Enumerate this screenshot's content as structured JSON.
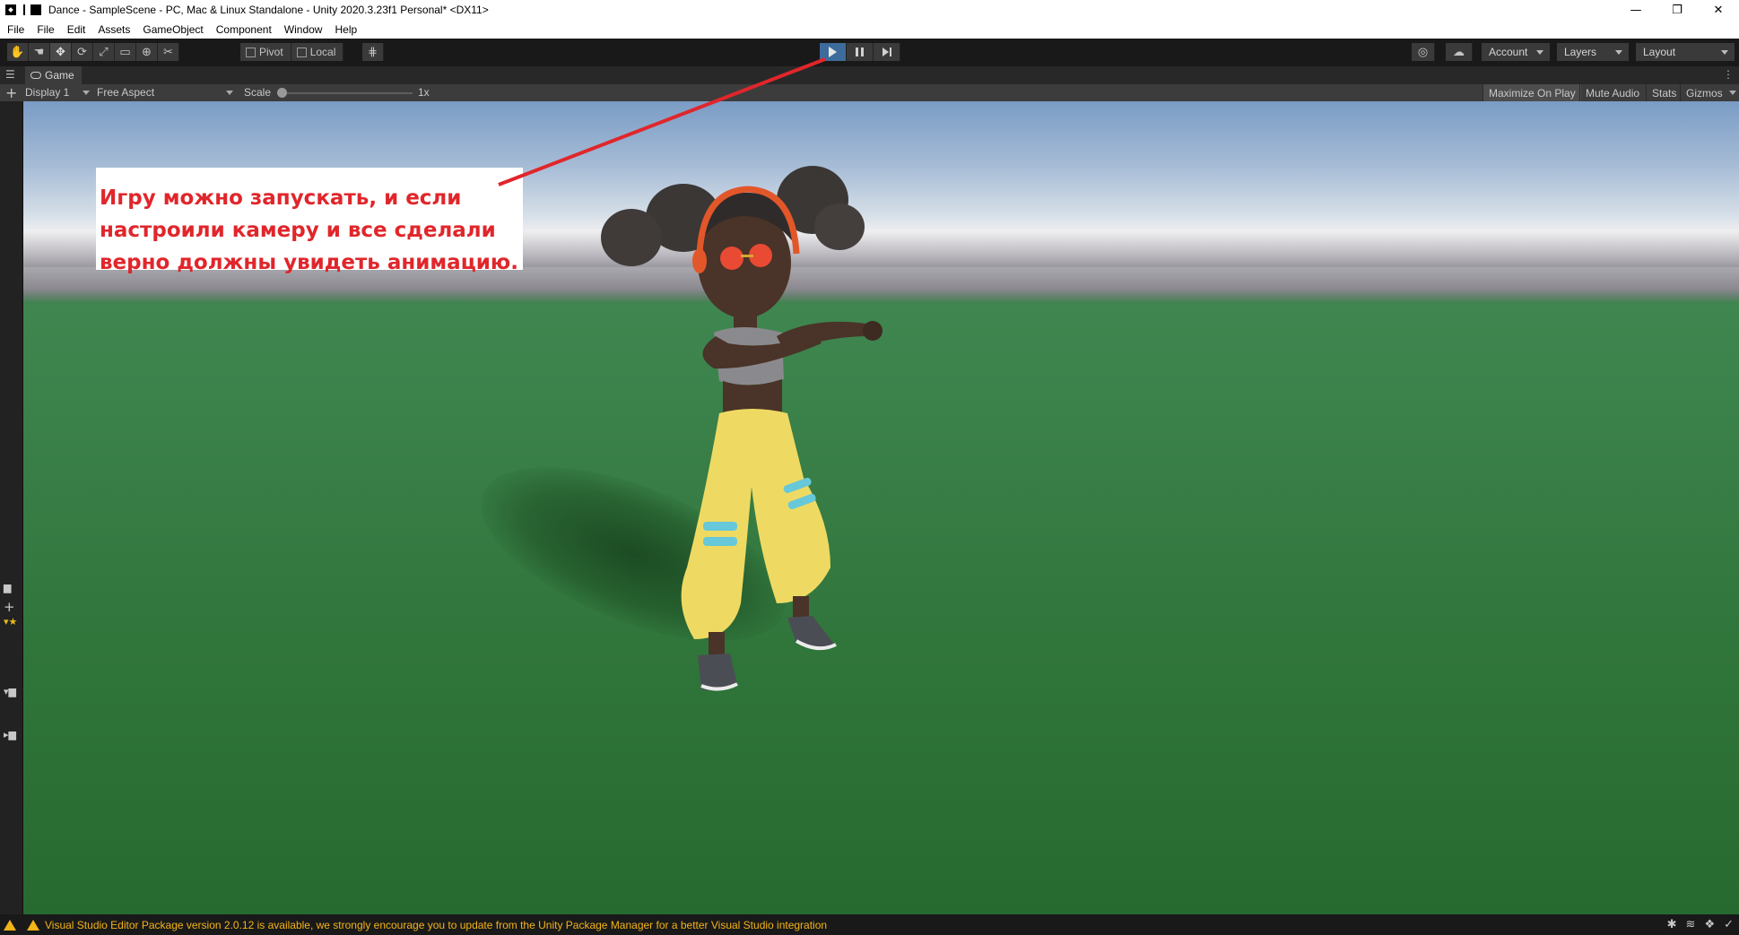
{
  "window": {
    "title": "Dance - SampleScene - PC, Mac & Linux Standalone - Unity 2020.3.23f1 Personal* <DX11>",
    "minimize_glyph": "—",
    "restore_glyph": "❐",
    "close_glyph": "✕"
  },
  "menubar": {
    "items": [
      "File",
      "File",
      "Edit",
      "Assets",
      "GameObject",
      "Component",
      "Window",
      "Help"
    ]
  },
  "toolbar": {
    "pivot_label": "Pivot",
    "local_label": "Local",
    "account_label": "Account",
    "layers_label": "Layers",
    "layout_label": "Layout",
    "play_state": "playing"
  },
  "game_tab": {
    "label": "Game"
  },
  "game_bar": {
    "display": "Display 1",
    "aspect": "Free Aspect",
    "scale_label": "Scale",
    "scale_value": "1x",
    "maximize_on_play": "Maximize On Play",
    "mute_audio": "Mute Audio",
    "stats": "Stats",
    "gizmos": "Gizmos"
  },
  "annotation": {
    "lines": [
      "Игру можно запускать, и если",
      "настроили камеру и все сделали",
      "верно должны увидеть анимацию."
    ],
    "color": "#e0262b"
  },
  "status": {
    "message": "Visual Studio Editor Package version 2.0.12 is available, we strongly encourage you to update from the Unity Package Manager for a better Visual Studio integration",
    "color": "#f2b418"
  },
  "colors": {
    "play_active": "#3d6b9b",
    "editor_bg": "#191919",
    "ground": "#3a8049",
    "sky": "#7a9cc5"
  }
}
